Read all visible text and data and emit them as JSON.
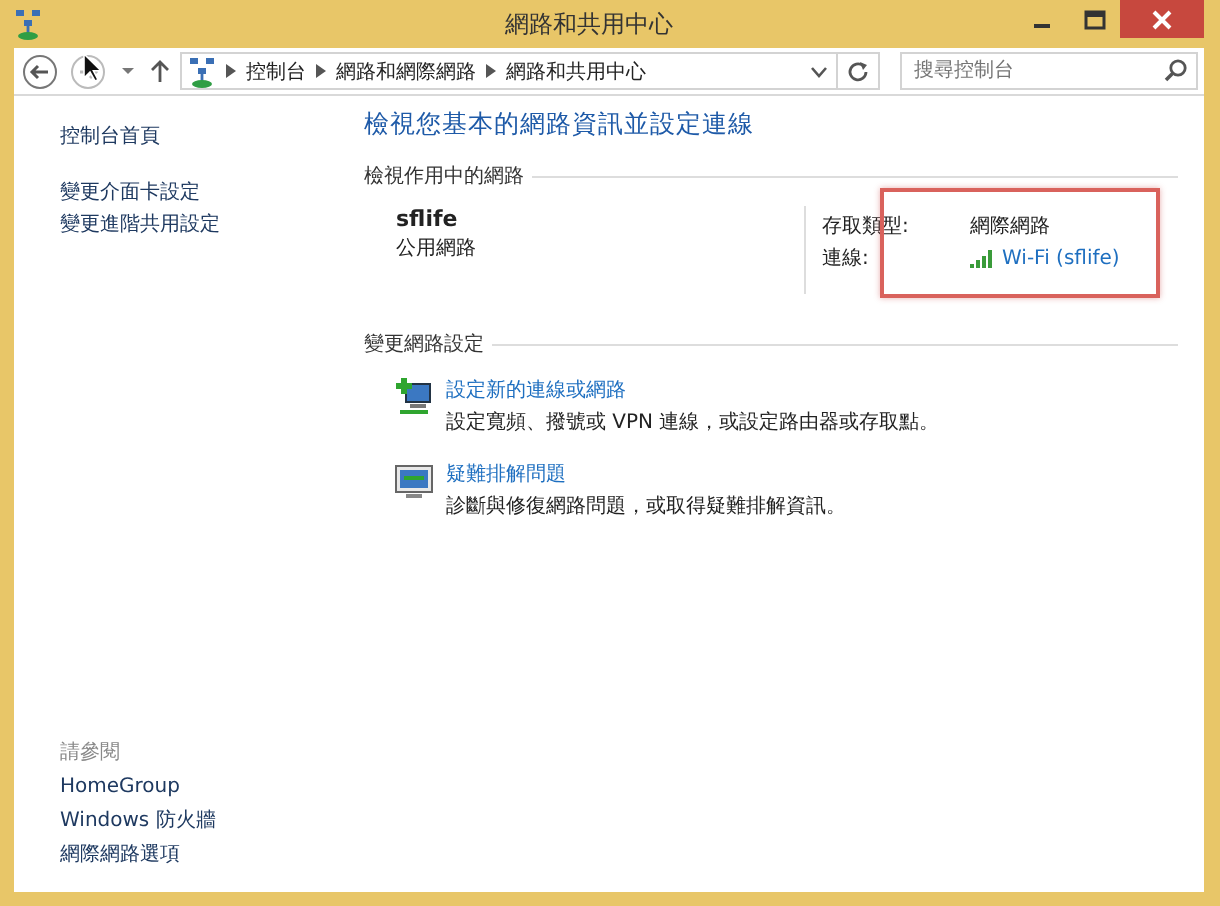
{
  "window": {
    "title": "網路和共用中心"
  },
  "nav": {
    "breadcrumb": [
      "控制台",
      "網路和網際網路",
      "網路和共用中心"
    ],
    "search": {
      "placeholder": "搜尋控制台"
    }
  },
  "sidebar": {
    "links": [
      "控制台首頁",
      "變更介面卡設定",
      "變更進階共用設定"
    ],
    "see_also": {
      "heading": "請參閱",
      "links": [
        "HomeGroup",
        "Windows 防火牆",
        "網際網路選項"
      ]
    }
  },
  "main": {
    "title": "檢視您基本的網路資訊並設定連線",
    "active_heading": "檢視作用中的網路",
    "network": {
      "name": "sflife",
      "type": "公用網路",
      "access_label": "存取類型:",
      "access_value": "網際網路",
      "connection_label": "連線:",
      "connection_value": "Wi-Fi (sflife)",
      "highlighted": true
    },
    "change_heading": "變更網路設定",
    "tasks": [
      {
        "kind": "new-connection",
        "title": "設定新的連線或網路",
        "description": "設定寬頻、撥號或 VPN 連線，或設定路由器或存取點。"
      },
      {
        "kind": "troubleshoot",
        "title": "疑難排解問題",
        "description": "診斷與修復網路問題，或取得疑難排解資訊。"
      }
    ]
  }
}
